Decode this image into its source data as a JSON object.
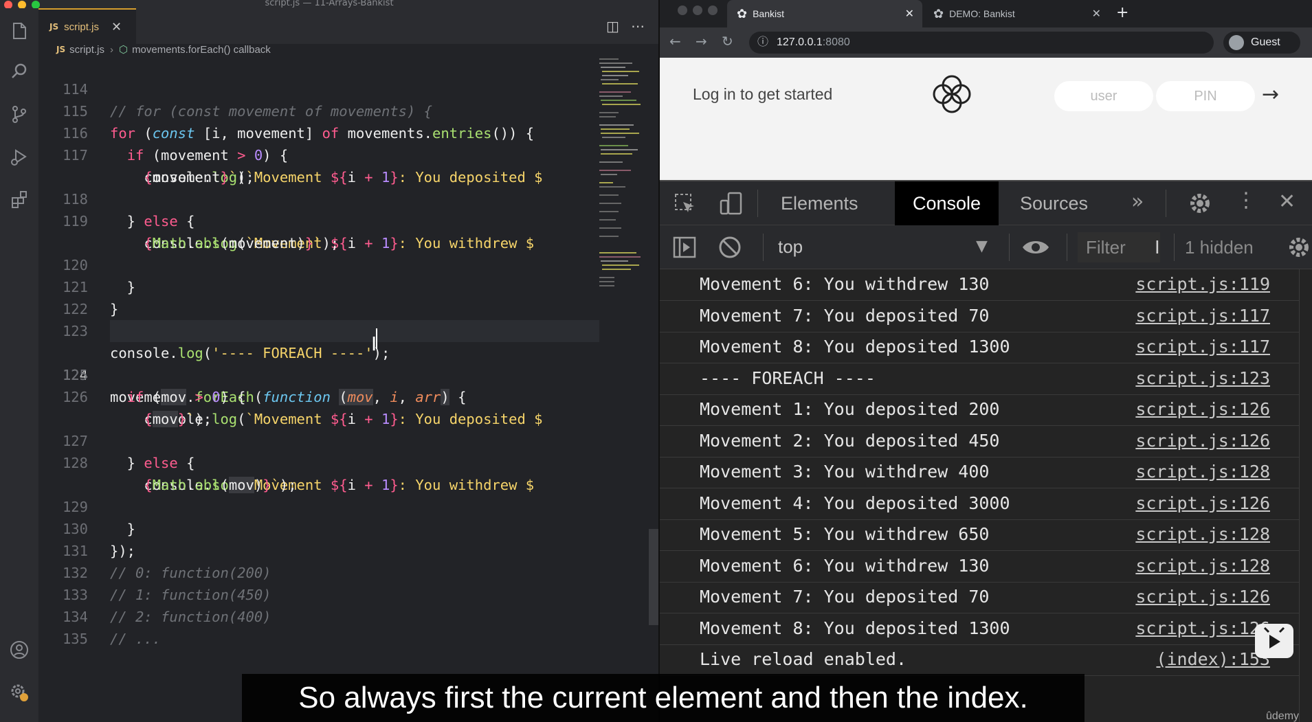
{
  "vscode": {
    "window_title": "script.js — 11-Arrays-Bankist",
    "tab": {
      "badge": "JS",
      "label": "script.js",
      "close": "✕"
    },
    "breadcrumb": {
      "badge": "JS",
      "file": "script.js",
      "symbol": "movements.forEach() callback"
    },
    "colors": {
      "accent_tab": "#d69e2e",
      "keyword": "#ff5c8f",
      "function": "#a9e070",
      "string": "#f7d56a",
      "number": "#b98cff"
    },
    "lines": [
      "114",
      "115",
      "116",
      "117",
      "118",
      "119",
      "120",
      "121",
      "122",
      "123",
      "124",
      "125",
      "126",
      "127",
      "128",
      "129",
      "130",
      "131",
      "132",
      "133",
      "134",
      "135"
    ],
    "code": {
      "l114": "// for (const movement of movements) {",
      "l123_str": "'---- FOREACH ----'",
      "l131": "// 0: function(200)",
      "l132": "// 1: function(450)",
      "l133": "// 2: function(400)",
      "l134": "// ..."
    },
    "activity_icons": [
      "files-icon",
      "search-icon",
      "source-control-icon",
      "run-debug-icon",
      "extensions-icon",
      "account-icon",
      "settings-gear-icon"
    ]
  },
  "browser": {
    "tabs": [
      {
        "label": "Bankist",
        "close": "✕"
      },
      {
        "label": "DEMO: Bankist",
        "close": "✕"
      }
    ],
    "new_tab": "+",
    "address": {
      "host": "127.0.0.1",
      "port": ":8080"
    },
    "profile": "Guest",
    "page": {
      "login_prompt": "Log in to get started",
      "user_placeholder": "user",
      "pin_placeholder": "PIN",
      "submit": "→"
    },
    "devtools": {
      "tabs": [
        "Elements",
        "Console",
        "Sources"
      ],
      "more_tabs": "»",
      "context": "top",
      "filter_placeholder": "Filter",
      "hidden": "1 hidden",
      "logs": [
        {
          "msg": "Movement 6: You withdrew 130",
          "src": "script.js:119"
        },
        {
          "msg": "Movement 7: You deposited 70",
          "src": "script.js:117"
        },
        {
          "msg": "Movement 8: You deposited 1300",
          "src": "script.js:117"
        },
        {
          "msg": "---- FOREACH ----",
          "src": "script.js:123"
        },
        {
          "msg": "Movement 1: You deposited 200",
          "src": "script.js:126"
        },
        {
          "msg": "Movement 2: You deposited 450",
          "src": "script.js:126"
        },
        {
          "msg": "Movement 3: You withdrew 400",
          "src": "script.js:128"
        },
        {
          "msg": "Movement 4: You deposited 3000",
          "src": "script.js:126"
        },
        {
          "msg": "Movement 5: You withdrew 650",
          "src": "script.js:128"
        },
        {
          "msg": "Movement 6: You withdrew 130",
          "src": "script.js:128"
        },
        {
          "msg": "Movement 7: You deposited 70",
          "src": "script.js:126"
        },
        {
          "msg": "Movement 8: You deposited 1300",
          "src": "script.js:126"
        },
        {
          "msg": "Live reload enabled.",
          "src": "(index):153"
        }
      ]
    }
  },
  "caption": "So always first the current element and then the index.",
  "watermark": "ûdemy"
}
